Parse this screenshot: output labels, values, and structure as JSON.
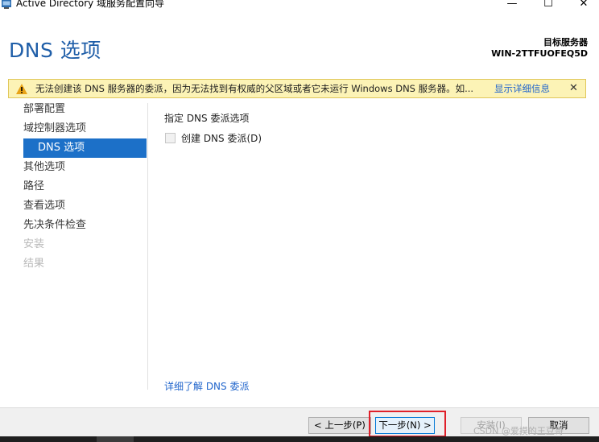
{
  "window": {
    "title": "Active Directory 域服务配置向导",
    "minimize_glyph": "—",
    "maximize_glyph": "☐",
    "close_glyph": "✕"
  },
  "header": {
    "page_title": "DNS 选项",
    "target_label": "目标服务器",
    "target_server": "WIN-2TTFUOFEQ5D"
  },
  "warning": {
    "icon": "warning-icon",
    "text": "无法创建该 DNS 服务器的委派，因为无法找到有权威的父区域或者它未运行 Windows DNS 服务器。如...",
    "link": "显示详细信息",
    "close_glyph": "✕",
    "bg_color": "#fcf3b6"
  },
  "sidebar": {
    "items": [
      {
        "label": "部署配置",
        "state": "normal"
      },
      {
        "label": "域控制器选项",
        "state": "normal"
      },
      {
        "label": "DNS 选项",
        "state": "active"
      },
      {
        "label": "其他选项",
        "state": "normal"
      },
      {
        "label": "路径",
        "state": "normal"
      },
      {
        "label": "查看选项",
        "state": "normal"
      },
      {
        "label": "先决条件检查",
        "state": "normal"
      },
      {
        "label": "安装",
        "state": "disabled"
      },
      {
        "label": "结果",
        "state": "disabled"
      }
    ],
    "active_color": "#1c70c8"
  },
  "content": {
    "section_label": "指定 DNS 委派选项",
    "checkbox_label": "创建 DNS 委派(D)",
    "checkbox_checked": false,
    "learn_more_link": "详细了解 DNS 委派"
  },
  "footer": {
    "prev_label": "< 上一步(P)",
    "next_label": "下一步(N) >",
    "install_label": "安装(I)",
    "cancel_label": "取消",
    "watermark": "CSDN @爱摸的王豆哥",
    "highlight_color": "#e0202a"
  }
}
